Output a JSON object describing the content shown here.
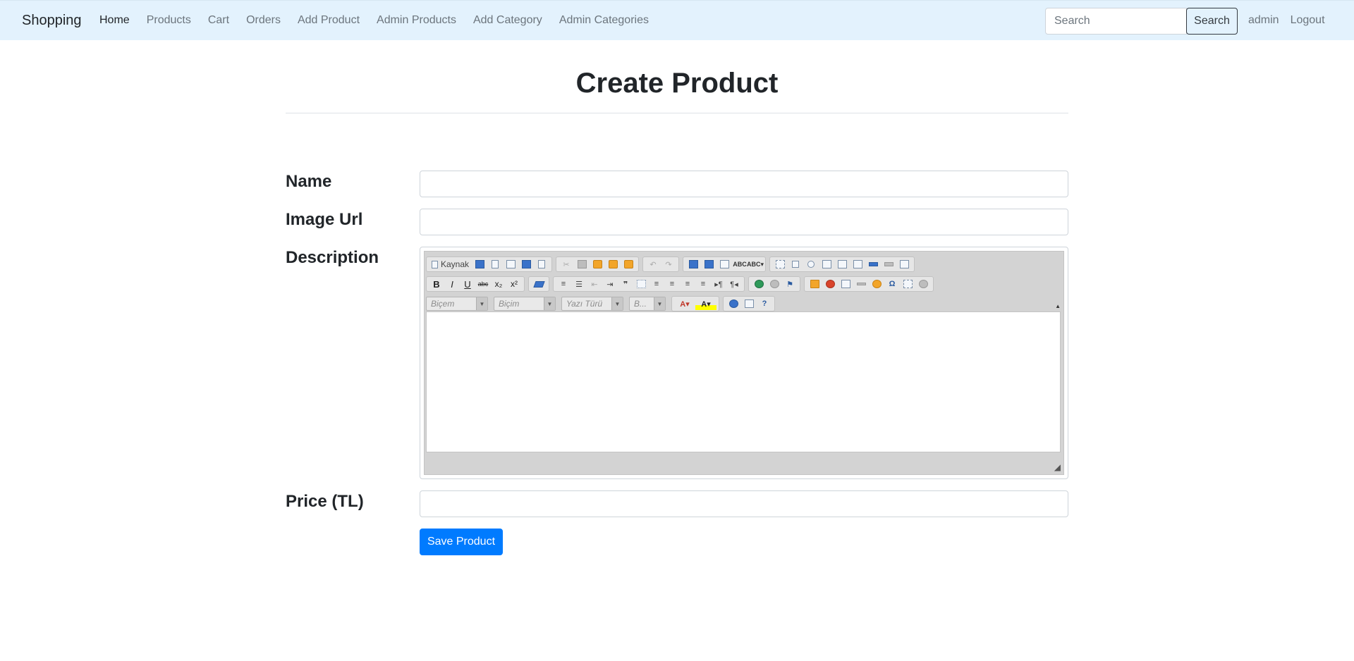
{
  "navbar": {
    "brand": "Shopping",
    "links": [
      "Home",
      "Products",
      "Cart",
      "Orders",
      "Add Product",
      "Admin Products",
      "Add Category",
      "Admin Categories"
    ],
    "search_placeholder": "Search",
    "search_button": "Search",
    "user": "admin",
    "logout": "Logout"
  },
  "page": {
    "title": "Create Product"
  },
  "form": {
    "name_label": "Name",
    "image_label": "Image Url",
    "description_label": "Description",
    "price_label": "Price (TL)",
    "save_label": "Save Product"
  },
  "editor": {
    "source_label": "Kaynak",
    "style_combo": "Biçem",
    "format_combo": "Biçim",
    "font_combo": "Yazı Türü",
    "size_combo": "B..."
  },
  "colors": {
    "navbar_bg": "#e3f2fd",
    "primary": "#007bff"
  }
}
